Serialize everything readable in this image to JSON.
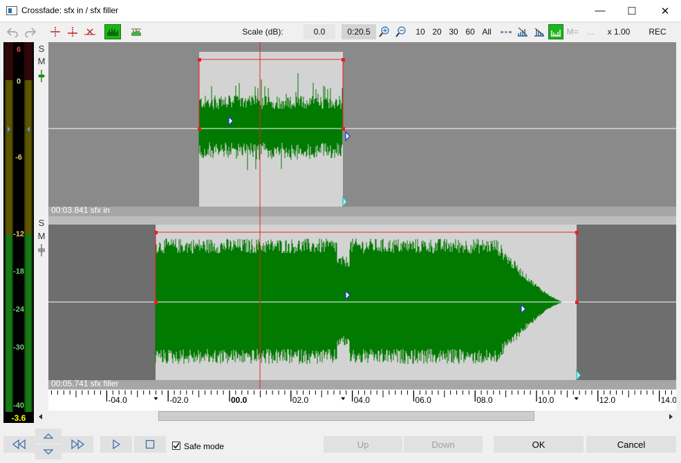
{
  "window": {
    "title": "Crossfade: sfx in / sfx filler",
    "minimize_glyph": "—",
    "maximize_glyph": "☐",
    "close_glyph": "✕"
  },
  "toolbar": {
    "scale_label": "Scale (dB):",
    "scale_value": "0.0",
    "zoom_value": "0:20.5",
    "zoom_presets": [
      "10",
      "20",
      "30",
      "60",
      "All"
    ],
    "m_label": "M=",
    "more_label": "...",
    "speed_value": "x 1.00",
    "rec_label": "REC",
    "icons": [
      "undo-icon",
      "redo-icon",
      "add-marker-icon",
      "move-marker-icon",
      "delete-marker-icon",
      "waveform-view-icon",
      "envelope-view-icon",
      "zoom-in-icon",
      "zoom-out-icon"
    ]
  },
  "meter": {
    "scale_labels": [
      "6",
      "0",
      "-6",
      "-12",
      "-18",
      "-24",
      "-30",
      "-40"
    ],
    "current_value": "-3.6",
    "colors": {
      "red": "#cc2020",
      "green": "#1a8f1a",
      "olive": "#6b6b00"
    }
  },
  "tracks": [
    {
      "solo": "S",
      "mute": "M",
      "label": "00:03.841 sfx in",
      "start_sec": -1.0,
      "end_sec": 3.7
    },
    {
      "solo": "S",
      "mute": "M",
      "label": "00:05.741 sfx filler",
      "start_sec": -2.4,
      "end_sec": 11.3
    }
  ],
  "playhead_sec": 1.0,
  "ruler": {
    "labels": [
      "-04.0",
      "-02.0",
      "00.0",
      "02.0",
      "04.0",
      "06.0",
      "08.0",
      "10.0",
      "12.0",
      "14.0"
    ]
  },
  "bottom": {
    "safe_mode_label": "Safe mode",
    "safe_mode_checked": true,
    "up_label": "Up",
    "down_label": "Down",
    "ok_label": "OK",
    "cancel_label": "Cancel"
  },
  "colors": {
    "waveform": "#007a00",
    "selection": "#e82020",
    "track_bg": "#8a8a8a",
    "clip_bg": "#d3d3d3"
  }
}
